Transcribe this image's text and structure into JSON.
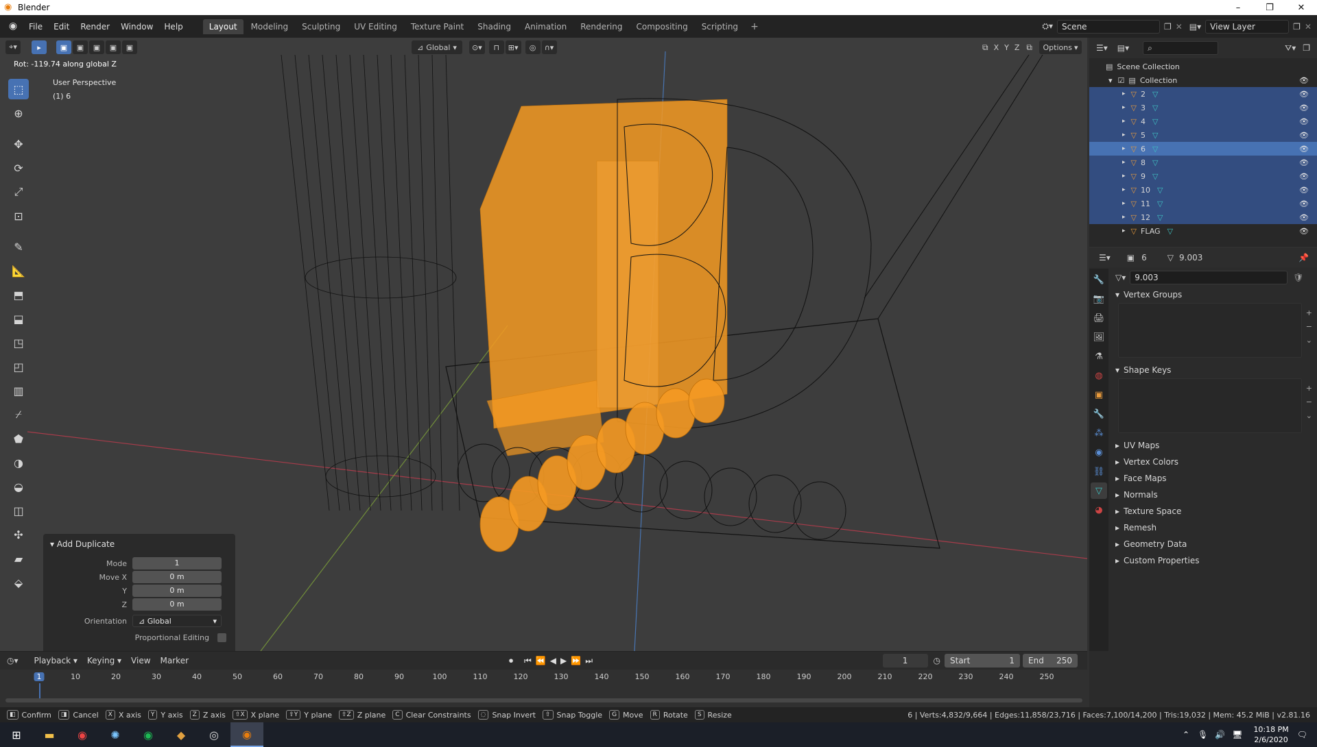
{
  "window": {
    "title": "Blender",
    "controls": [
      "–",
      "❐",
      "✕"
    ]
  },
  "menubar": {
    "menus": [
      "File",
      "Edit",
      "Render",
      "Window",
      "Help"
    ],
    "workspaces": [
      "Layout",
      "Modeling",
      "Sculpting",
      "UV Editing",
      "Texture Paint",
      "Shading",
      "Animation",
      "Rendering",
      "Compositing",
      "Scripting"
    ],
    "active_workspace": "Layout",
    "add_tab": "+",
    "scene": "Scene",
    "view_layer": "View Layer"
  },
  "viewport": {
    "orientation": "Global",
    "axes": [
      "X",
      "Y",
      "Z"
    ],
    "options_label": "Options",
    "status_text": "Rot: -119.74 along global Z",
    "view_name": "User Perspective",
    "object_info": "(1) 6"
  },
  "redo_panel": {
    "title": "Add Duplicate",
    "mode_label": "Mode",
    "mode_value": "1",
    "move_x_label": "Move X",
    "move_x": "0 m",
    "y_label": "Y",
    "y": "0 m",
    "z_label": "Z",
    "z": "0 m",
    "orientation_label": "Orientation",
    "orientation_value": "Global",
    "proportional_label": "Proportional Editing"
  },
  "outliner": {
    "scene_collection": "Scene Collection",
    "collection": "Collection",
    "objects": [
      "2",
      "3",
      "4",
      "5",
      "6",
      "8",
      "9",
      "10",
      "11",
      "12",
      "FLAG"
    ],
    "active_object": "6"
  },
  "properties": {
    "object_name": "6",
    "mesh_name": "9.003",
    "mesh_data_field": "9.003",
    "panels_open": [
      "Vertex Groups",
      "Shape Keys"
    ],
    "panels_closed": [
      "UV Maps",
      "Vertex Colors",
      "Face Maps",
      "Normals",
      "Texture Space",
      "Remesh",
      "Geometry Data",
      "Custom Properties"
    ]
  },
  "timeline": {
    "menus": [
      "Playback",
      "Keying",
      "View",
      "Marker"
    ],
    "current_frame": "1",
    "start_label": "Start",
    "start": "1",
    "end_label": "End",
    "end": "250",
    "ticks": [
      "1",
      "10",
      "20",
      "30",
      "40",
      "50",
      "60",
      "70",
      "80",
      "90",
      "100",
      "110",
      "120",
      "130",
      "140",
      "150",
      "160",
      "170",
      "180",
      "190",
      "200",
      "210",
      "220",
      "230",
      "240",
      "250"
    ]
  },
  "statusbar": {
    "hints": [
      {
        "key": "",
        "label": "Confirm"
      },
      {
        "key": "",
        "label": "Cancel"
      },
      {
        "key": "X",
        "label": "X axis"
      },
      {
        "key": "Y",
        "label": "Y axis"
      },
      {
        "key": "Z",
        "label": "Z axis"
      },
      {
        "key": "⇧X",
        "label": "X plane"
      },
      {
        "key": "⇧Y",
        "label": "Y plane"
      },
      {
        "key": "⇧Z",
        "label": "Z plane"
      },
      {
        "key": "C",
        "label": "Clear Constraints"
      },
      {
        "key": "",
        "label": "Snap Invert"
      },
      {
        "key": "⇧",
        "label": "Snap Toggle"
      },
      {
        "key": "G",
        "label": "Move"
      },
      {
        "key": "R",
        "label": "Rotate"
      },
      {
        "key": "S",
        "label": "Resize"
      }
    ],
    "stats": "6 | Verts:4,832/9,664 | Edges:11,858/23,716 | Faces:7,100/14,200 | Tris:19,032 | Mem: 45.2 MiB | v2.81.16"
  },
  "taskbar": {
    "time": "10:18 PM",
    "date": "2/6/2020"
  },
  "colors": {
    "accent": "#4772b3",
    "selection_orange": "#f59a23",
    "wire_black": "#111111",
    "x_axis": "#c23c4e",
    "y_axis": "#7ea33a",
    "z_axis": "#4a7cc0"
  }
}
